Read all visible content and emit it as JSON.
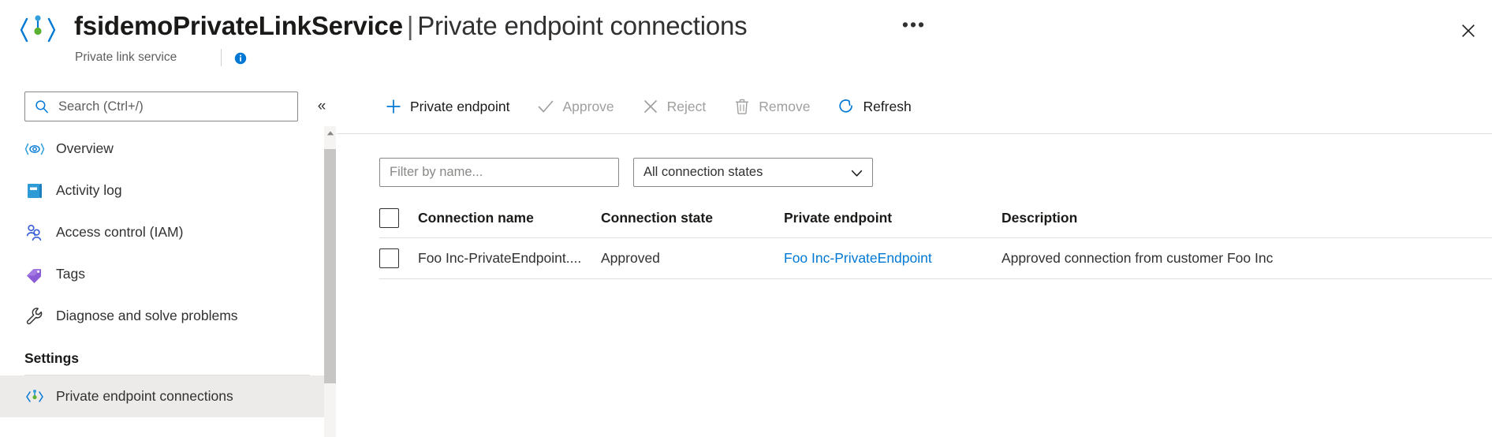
{
  "header": {
    "resource_name": "fsidemoPrivateLinkService",
    "separator": "|",
    "page_title": "Private endpoint connections",
    "ellipsis_label": "•••",
    "subtitle": "Private link service",
    "info_icon": "info-icon",
    "close_icon": "close-icon",
    "logo_icon": "private-link-service-icon"
  },
  "sidebar": {
    "search_placeholder": "Search (Ctrl+/)",
    "search_value": "",
    "search_icon": "search-icon",
    "collapse_label": "«",
    "items": [
      {
        "label": "Overview",
        "icon": "overview-eye-icon",
        "selected": false,
        "type": "item"
      },
      {
        "label": "Activity log",
        "icon": "activity-log-icon",
        "selected": false,
        "type": "item"
      },
      {
        "label": "Access control (IAM)",
        "icon": "access-control-people-icon",
        "selected": false,
        "type": "item"
      },
      {
        "label": "Tags",
        "icon": "tag-icon",
        "selected": false,
        "type": "item"
      },
      {
        "label": "Diagnose and solve problems",
        "icon": "wrench-icon",
        "selected": false,
        "type": "item"
      },
      {
        "label": "Settings",
        "icon": "",
        "selected": false,
        "type": "group"
      },
      {
        "label": "Private endpoint connections",
        "icon": "private-link-service-icon",
        "selected": true,
        "type": "item"
      }
    ],
    "scrollbar": {
      "up_arrow_icon": "scroll-up-arrow-icon"
    }
  },
  "toolbar": {
    "buttons": [
      {
        "label": "Private endpoint",
        "icon": "plus-icon",
        "enabled": true
      },
      {
        "label": "Approve",
        "icon": "check-icon",
        "enabled": false
      },
      {
        "label": "Reject",
        "icon": "x-icon",
        "enabled": false
      },
      {
        "label": "Remove",
        "icon": "trash-icon",
        "enabled": false
      },
      {
        "label": "Refresh",
        "icon": "refresh-icon",
        "enabled": true
      }
    ]
  },
  "filters": {
    "name_placeholder": "Filter by name...",
    "name_value": "",
    "state_selected": "All connection states",
    "state_chevron_icon": "chevron-down-icon"
  },
  "table": {
    "select_all_checked": false,
    "columns": [
      "Connection name",
      "Connection state",
      "Private endpoint",
      "Description"
    ],
    "rows": [
      {
        "checked": false,
        "connection_name": "Foo Inc-PrivateEndpoint....",
        "connection_state": "Approved",
        "private_endpoint": "Foo Inc-PrivateEndpoint",
        "description": "Approved connection from customer Foo Inc"
      }
    ]
  },
  "colors": {
    "accent_blue": "#0078d4",
    "link_blue": "#0078d4",
    "text_primary": "#1b1a19",
    "text_secondary": "#605e5c",
    "disabled_gray": "#a19f9d",
    "selected_bg": "#edebe9",
    "border_gray": "#e1dfdd"
  }
}
